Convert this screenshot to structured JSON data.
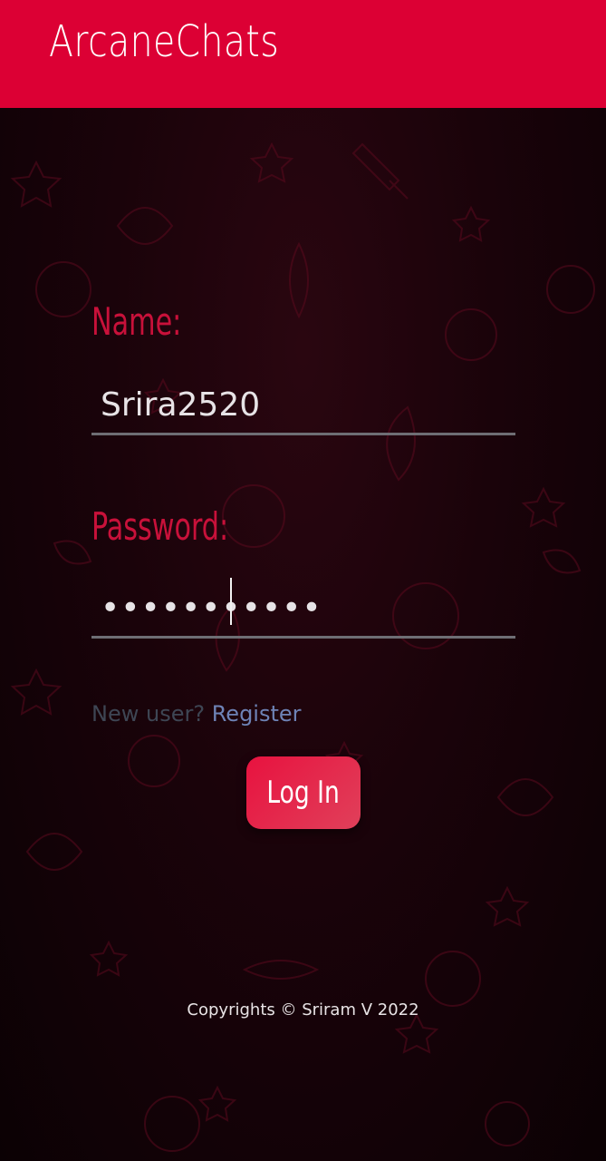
{
  "header": {
    "title": "ArcaneChats"
  },
  "form": {
    "name_label": "Name:",
    "name_value": "Srira2520",
    "password_label": "Password:",
    "password_value": "•••••••••••",
    "new_user_text": "New user?",
    "register_label": "Register",
    "login_label": "Log In"
  },
  "footer": {
    "text": "Copyrights © Sriram V 2022"
  },
  "colors": {
    "header_bg": "#dc0034",
    "label": "#c8113a",
    "register_link": "#6e83b6",
    "button": "#e8123f",
    "background": "#1a030a"
  },
  "icons": [
    "space-doodle-pattern"
  ]
}
